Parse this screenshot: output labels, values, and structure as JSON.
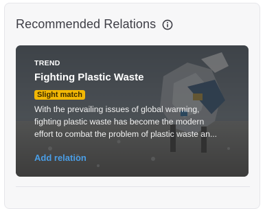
{
  "panel": {
    "title": "Recommended Relations",
    "info_icon": "info-icon"
  },
  "card": {
    "type": "TREND",
    "title": "Fighting Plastic Waste",
    "match": "Slight match",
    "description_line1": "With the prevailing issues of global warming,",
    "description_line2": "fighting plastic waste has become the modern",
    "description_line3": "effort to combat the problem of plastic waste an...",
    "action": "Add relation",
    "colors": {
      "badge": "#f2b705",
      "link": "#4a9ee6"
    }
  }
}
